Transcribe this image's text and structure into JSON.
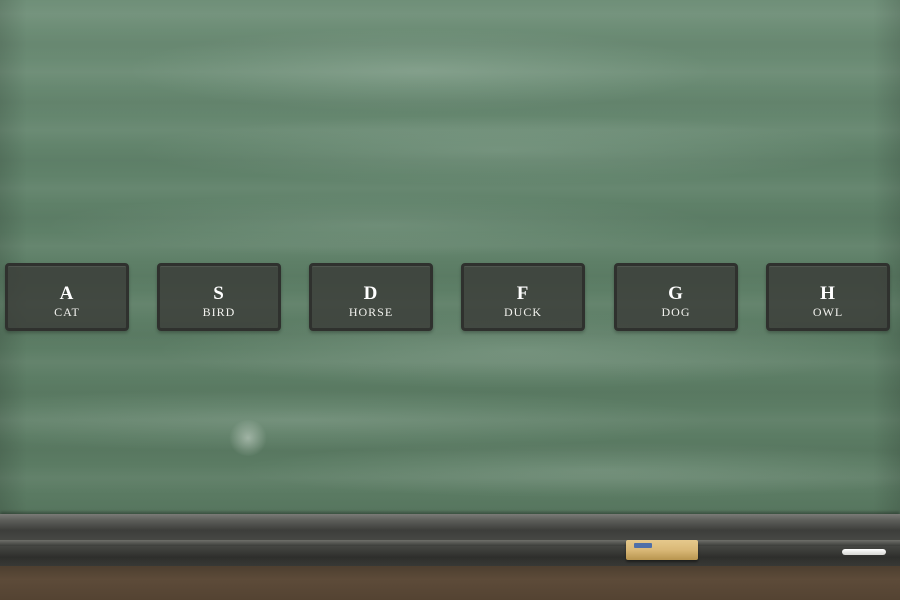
{
  "keys": [
    {
      "letter": "A",
      "label": "CAT"
    },
    {
      "letter": "S",
      "label": "BIRD"
    },
    {
      "letter": "D",
      "label": "HORSE"
    },
    {
      "letter": "F",
      "label": "DUCK"
    },
    {
      "letter": "G",
      "label": "DOG"
    },
    {
      "letter": "H",
      "label": "OWL"
    }
  ],
  "colors": {
    "board": "#5f8169",
    "key_fill": "#3a3c38",
    "key_border": "#2f312e",
    "text": "#ffffff"
  }
}
